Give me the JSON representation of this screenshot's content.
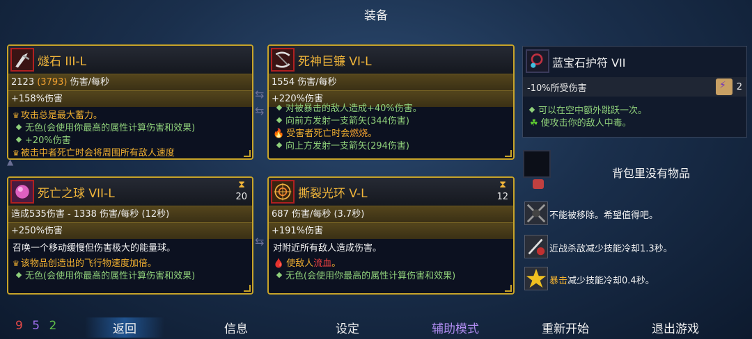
{
  "header": {
    "title": "装备"
  },
  "weapons": [
    {
      "name": "燧石 III-L",
      "stat_main": "2123",
      "stat_bonus": "(3793)",
      "stat_unit": "伤害/每秒",
      "stat_dmg": "+158%伤害",
      "lines": [
        {
          "type": "gold",
          "text": "攻击总是最大蓄力。"
        },
        {
          "type": "green",
          "text": "无色(会使用你最高的属性计算伤害和效果)"
        },
        {
          "type": "green",
          "text": "+20%伤害"
        },
        {
          "type": "gold",
          "text": "被击中者死亡时会将周围所有敌人速度"
        }
      ]
    },
    {
      "name": "死神巨镰 VI-L",
      "stat_main": "1554 伤害/每秒",
      "stat_dmg": "+220%伤害",
      "lines": [
        {
          "type": "green",
          "text": "对被暴击的敌人造成+40%伤害。"
        },
        {
          "type": "green",
          "text": "向前方发射一支箭矢(344伤害)"
        },
        {
          "type": "burn",
          "prefix": "受害者死亡时会",
          "highlight": "燃烧",
          "suffix": "。"
        },
        {
          "type": "green",
          "text": "向上方发射一支箭矢(294伤害)"
        }
      ]
    },
    {
      "name": "死亡之球 VII-L",
      "cooldown": "20",
      "stat_main": "造成535伤害 - 1338 伤害/每秒 (12秒)",
      "stat_dmg": "+250%伤害",
      "desc": "召唤一个移动缓慢但伤害极大的能量球。",
      "lines": [
        {
          "type": "gold",
          "text": "该物品创造出的飞行物速度加倍。"
        },
        {
          "type": "green",
          "text": "无色(会使用你最高的属性计算伤害和效果)"
        }
      ]
    },
    {
      "name": "撕裂光环 V-L",
      "cooldown": "12",
      "stat_main": "687 伤害/每秒 (3.7秒)",
      "stat_dmg": "+191%伤害",
      "desc": "对附近所有敌人造成伤害。",
      "lines": [
        {
          "type": "bleed",
          "prefix": "使敌人",
          "highlight": "流血",
          "suffix": "。"
        },
        {
          "type": "green",
          "text": "无色(会使用你最高的属性计算伤害和效果)"
        }
      ]
    }
  ],
  "amulet": {
    "name": "蓝宝石护符 VII",
    "stat": "-10%所受伤害",
    "scroll_count": "2",
    "lines": [
      "可以在空中额外跳跃一次。",
      "使攻击你的敌人中毒。"
    ]
  },
  "backpack": {
    "empty_text": "背包里没有物品"
  },
  "perks": [
    {
      "text": "不能被移除。希望值得吧。"
    },
    {
      "text": "近战杀敌减少技能冷却1.3秒。"
    },
    {
      "highlight": "暴击",
      "text": "减少技能冷却0.4秒。"
    }
  ],
  "stats": {
    "brutality": "9",
    "tactics": "5",
    "survival": "2"
  },
  "colors": {
    "brutality": "#e04848",
    "tactics": "#a070f0",
    "survival": "#60c048",
    "gold": "#f2b63a"
  },
  "menu": {
    "back": "返回",
    "info": "信息",
    "settings": "设定",
    "assist": "辅助模式",
    "restart": "重新开始",
    "quit": "退出游戏"
  }
}
